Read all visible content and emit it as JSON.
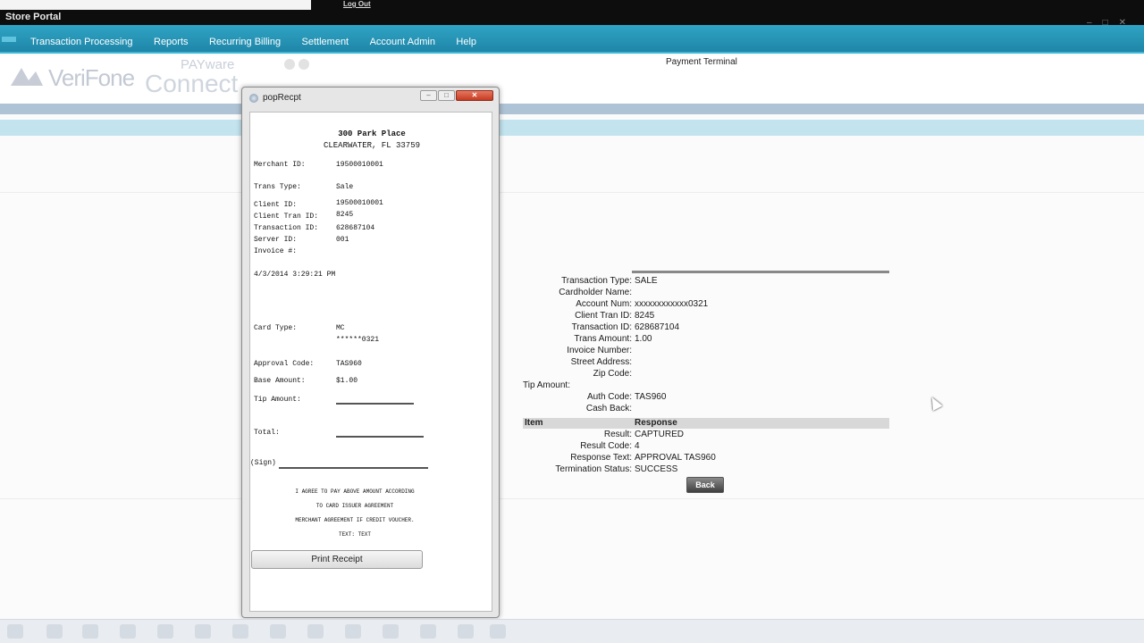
{
  "window": {
    "title": "Store Portal",
    "logout_label": "Log Out"
  },
  "nav": {
    "items": [
      "Transaction Processing",
      "Reports",
      "Recurring Billing",
      "Settlement",
      "Account Admin",
      "Help"
    ]
  },
  "header": {
    "verifone_logo_text": "VeriFone",
    "payware_logo_top": "PAYware",
    "payware_logo_main": "Connect",
    "page_title": "Payment Terminal"
  },
  "results": {
    "rows": [
      {
        "label": "Transaction Type:",
        "value": "SALE"
      },
      {
        "label": "Cardholder Name:",
        "value": ""
      },
      {
        "label": "Account Num:",
        "value": "xxxxxxxxxxxx0321"
      },
      {
        "label": "Client Tran ID:",
        "value": "8245"
      },
      {
        "label": "Transaction ID:",
        "value": "628687104"
      },
      {
        "label": "Trans Amount:",
        "value": "1.00"
      },
      {
        "label": "Invoice Number:",
        "value": ""
      },
      {
        "label": "Street Address:",
        "value": ""
      },
      {
        "label": "Zip Code:",
        "value": ""
      },
      {
        "label": "Tip Amount:",
        "value": ""
      },
      {
        "label": "Auth Code:",
        "value": "TAS960"
      },
      {
        "label": "Cash Back:",
        "value": ""
      }
    ],
    "section_header": {
      "item": "Item",
      "response": "Response"
    },
    "response_rows": [
      {
        "label": "Result:",
        "value": "CAPTURED"
      },
      {
        "label": "Result Code:",
        "value": "4"
      },
      {
        "label": "Response Text:",
        "value": "APPROVAL TAS960"
      },
      {
        "label": "Termination Status:",
        "value": "SUCCESS"
      }
    ],
    "back_label": "Back"
  },
  "popup": {
    "title": "popRecpt",
    "address_line1": "300 Park Place",
    "address_line2": "CLEARWATER, FL 33759",
    "merchant_id_label": "Merchant ID:",
    "merchant_id": "19500010001",
    "trans_type_label": "Trans Type:",
    "trans_type": "Sale",
    "client_id_label": "Client ID:",
    "client_id": "19500010001",
    "client_tran_id_label": "Client Tran ID:",
    "client_tran_id": "8245",
    "transaction_id_label": "Transaction ID:",
    "transaction_id": "628687104",
    "server_id_label": "Server ID:",
    "server_id": "001",
    "invoice_label": "Invoice #:",
    "datetime": "4/3/2014 3:29:21 PM",
    "card_type_label": "Card Type:",
    "card_type": "MC",
    "card_number": "******0321",
    "approval_code_label": "Approval Code:",
    "approval_code": "TAS960",
    "base_amount_label": "Base Amount:",
    "base_amount": "$1.00",
    "tip_amount_label": "Tip Amount:",
    "total_label": "Total:",
    "sign_label": "(Sign)",
    "agreement_line1": "I AGREE TO PAY ABOVE AMOUNT ACCORDING",
    "agreement_line2": "TO CARD ISSUER AGREEMENT",
    "agreement_line3": "MERCHANT AGREEMENT IF CREDIT VOUCHER.",
    "agreement_line4": "TEXT: TEXT",
    "print_label": "Print Receipt"
  }
}
